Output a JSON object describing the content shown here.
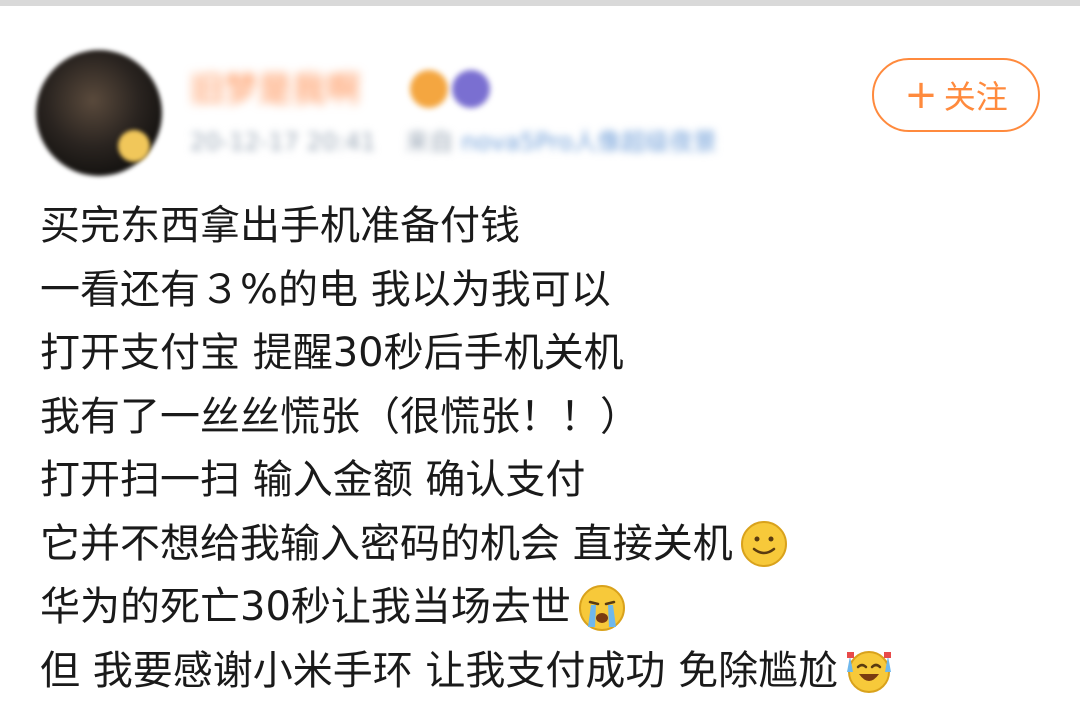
{
  "header": {
    "username": "旧梦是我啊",
    "timestamp": "20-12-17 20:41",
    "source_prefix": "来自",
    "device": "nova5Pro人像超级夜景"
  },
  "follow_button": {
    "plus": "+",
    "label": "关注"
  },
  "post": {
    "lines": [
      "买完东西拿出手机准备付钱",
      "一看还有３%的电 我以为我可以",
      "打开支付宝 提醒30秒后手机关机",
      "我有了一丝丝慌张（很慌张！！）",
      "打开扫一扫 输入金额 确认支付",
      "它并不想给我输入密码的机会 直接关机",
      "华为的死亡30秒让我当场去世",
      "但 我要感谢小米手环 让我支付成功 免除尴尬"
    ]
  },
  "icons": {
    "line6": "smile-icon",
    "line7": "crying-icon",
    "line8": "laugh-cry-icon"
  },
  "colors": {
    "accent": "#ff8a3d",
    "text": "#1a1a1a",
    "emoji_yellow": "#f7c93a"
  }
}
